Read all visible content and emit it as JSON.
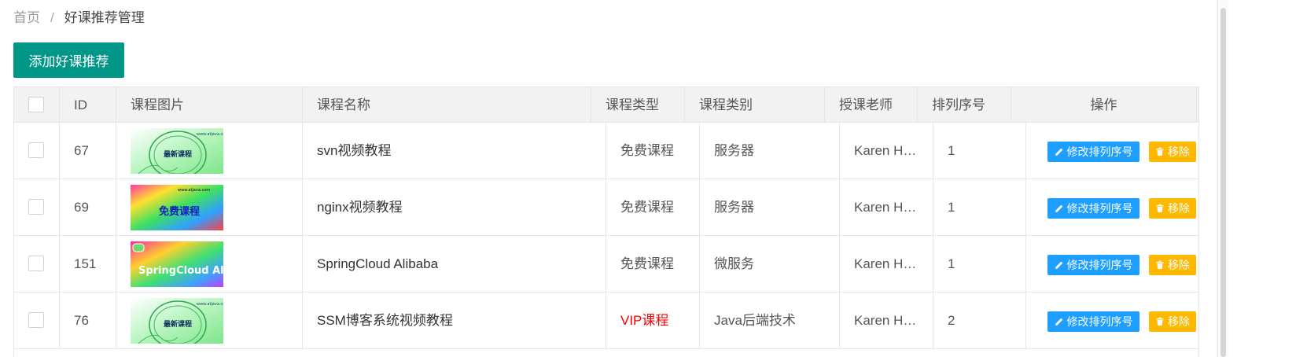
{
  "breadcrumb": {
    "home": "首页",
    "separator": "/",
    "current": "好课推荐管理"
  },
  "toolbar": {
    "add_label": "添加好课推荐"
  },
  "table": {
    "headers": {
      "id": "ID",
      "image": "课程图片",
      "name": "课程名称",
      "type": "课程类型",
      "category": "课程类别",
      "teacher": "授课老师",
      "sort": "排列序号",
      "actions": "操作"
    },
    "rows": [
      {
        "id": "67",
        "image_icon": "course-cover-zuixin-kecheng",
        "name": "svn视频教程",
        "type": "免费课程",
        "category": "服务器",
        "teacher": "Karen Hoang",
        "sort": "1"
      },
      {
        "id": "69",
        "image_icon": "course-cover-mianfei-kecheng",
        "name": "nginx视频教程",
        "type": "免费课程",
        "category": "服务器",
        "teacher": "Karen Hoang",
        "sort": "1"
      },
      {
        "id": "151",
        "image_icon": "course-cover-springcloud",
        "name": "SpringCloud Alibaba",
        "type": "免费课程",
        "category": "微服务",
        "teacher": "Karen Hoang",
        "sort": "1"
      },
      {
        "id": "76",
        "image_icon": "course-cover-zuixin-kecheng",
        "name": "SSM博客系统视频教程",
        "type": "VIP课程",
        "category": "Java后端技术",
        "teacher": "Karen Hoang",
        "sort": "2"
      }
    ],
    "edit_label": "修改排列序号",
    "delete_label": "移除"
  },
  "covers": {
    "zuixin": {
      "text": "最新课程",
      "site": "www.atjava.com"
    },
    "mianfei": {
      "text": "免费课程",
      "site": "www.atjava.com"
    },
    "springcloud": {
      "text": "SpringCloud Ali"
    }
  },
  "colors": {
    "primary": "#009688",
    "edit": "#1e9fff",
    "delete": "#ffb800",
    "vip": "#ff0000",
    "header_bg": "#f2f2f2"
  }
}
